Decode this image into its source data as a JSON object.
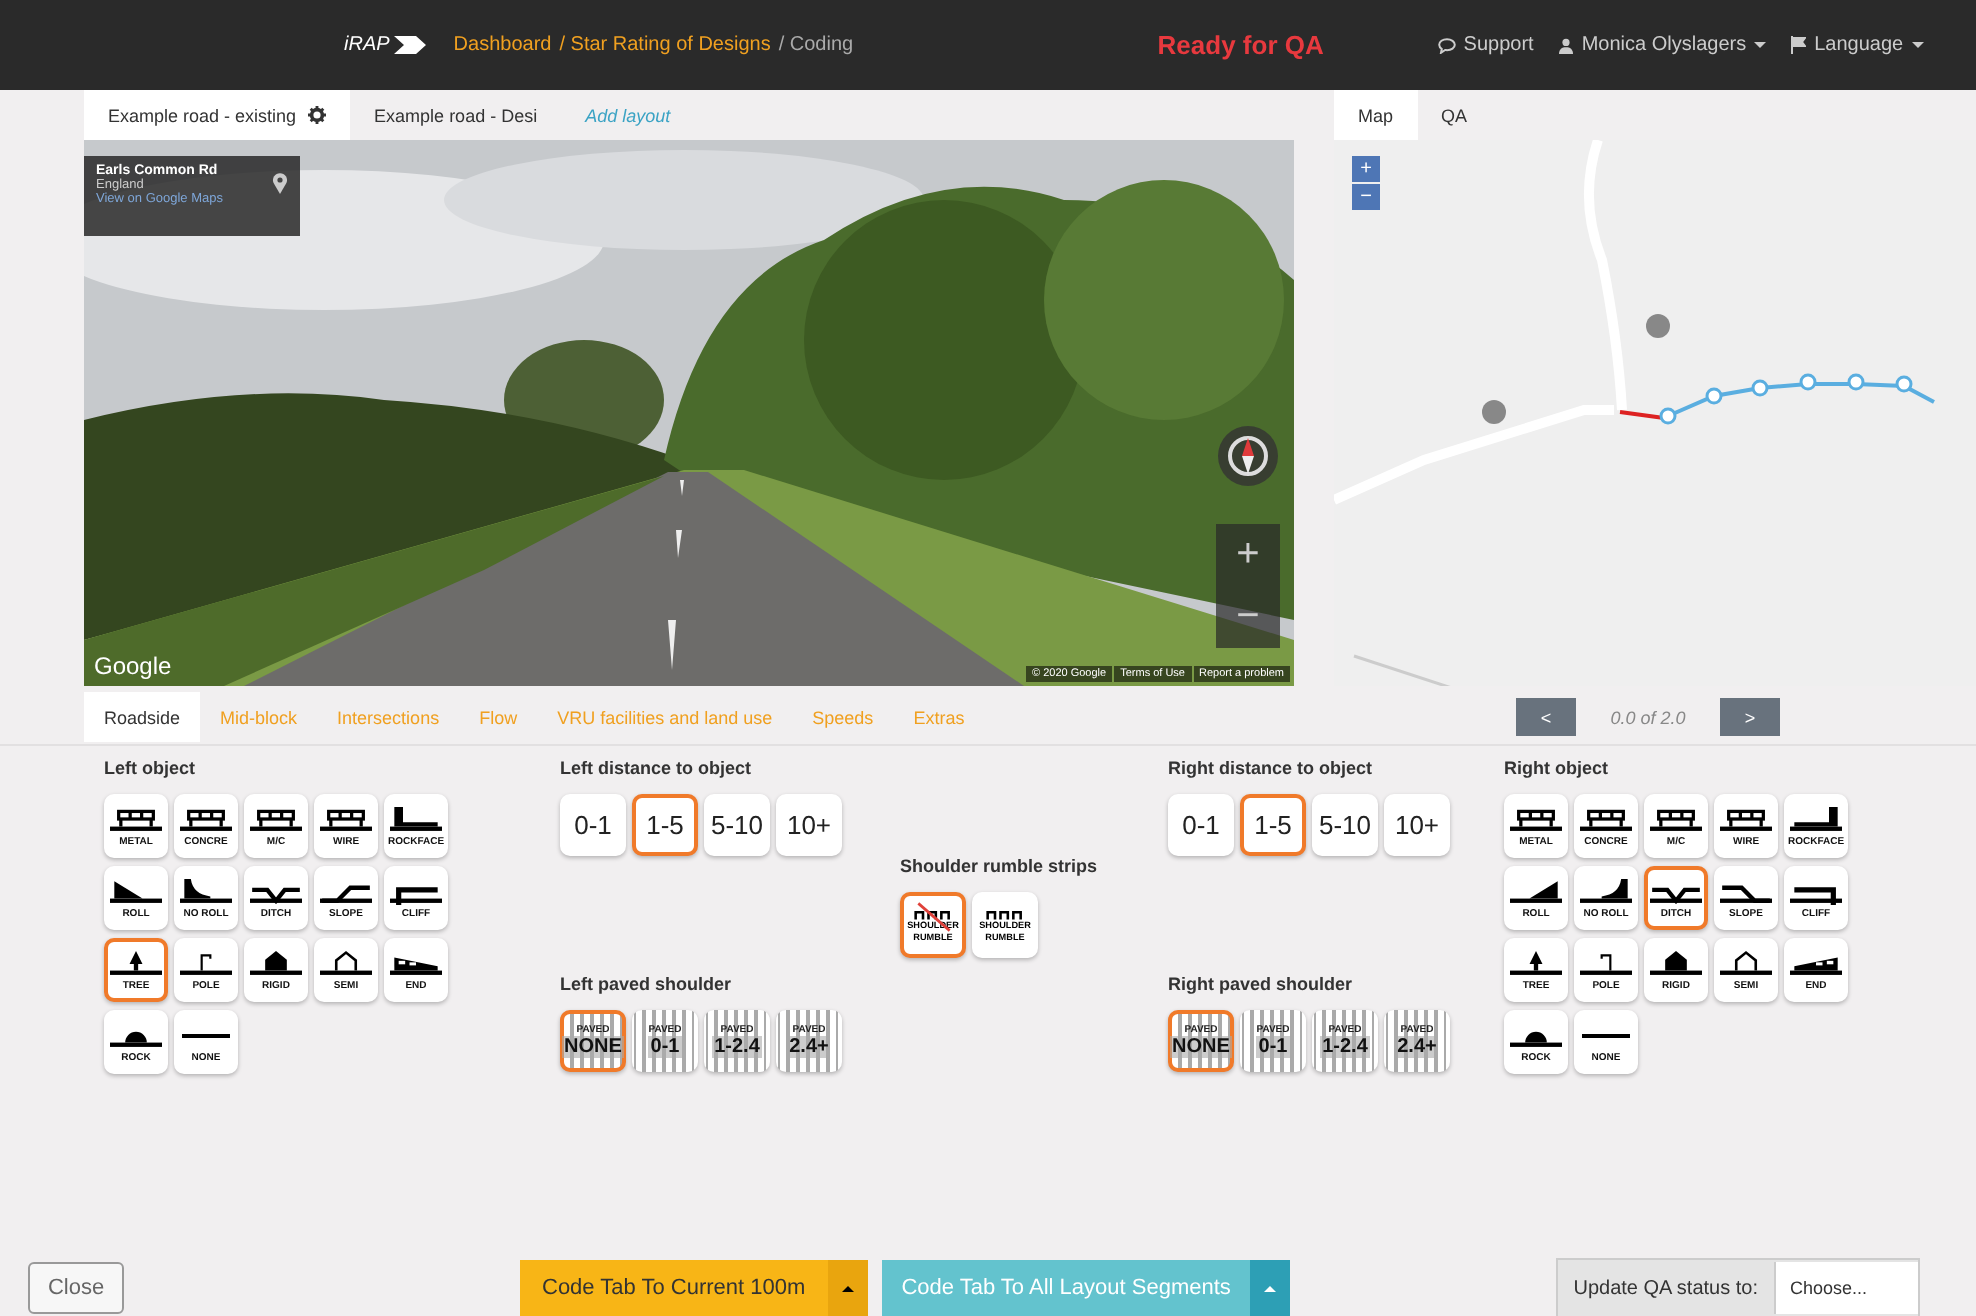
{
  "header": {
    "logo": "iRAP",
    "breadcrumb": [
      {
        "label": "Dashboard",
        "kind": "link"
      },
      {
        "label": "/ Star Rating of Designs",
        "kind": "link"
      },
      {
        "label": "/ Coding",
        "kind": "current"
      }
    ],
    "status": "Ready for QA",
    "menu": [
      {
        "label": "Support",
        "dropdown": false
      },
      {
        "label": "Monica Olyslagers",
        "dropdown": true
      },
      {
        "label": "Language",
        "dropdown": true
      }
    ]
  },
  "layout_tabs": [
    {
      "label": "Example road - existing",
      "kind": "layout",
      "selected": true,
      "settings": true
    },
    {
      "label": "Example road - Desi",
      "kind": "layout",
      "selected": false,
      "settings": false
    },
    {
      "label": "Add layout",
      "kind": "add",
      "selected": false,
      "settings": false
    }
  ],
  "street_view": {
    "place": {
      "title": "Earls Common Rd",
      "subtitle": "England",
      "link": "View on Google Maps"
    },
    "logo": "Google",
    "footer": [
      "© 2020 Google",
      "Terms of Use",
      "Report a problem"
    ],
    "zoom": [
      "+",
      "−"
    ]
  },
  "map_panel": {
    "tabs": [
      {
        "label": "Map",
        "selected": true
      },
      {
        "label": "QA",
        "selected": false
      }
    ],
    "zoom": [
      "+",
      "−"
    ]
  },
  "category_tabs": [
    {
      "label": "Roadside",
      "selected": true
    },
    {
      "label": "Mid-block",
      "selected": false
    },
    {
      "label": "Intersections",
      "selected": false
    },
    {
      "label": "Flow",
      "selected": false
    },
    {
      "label": "VRU facilities and land use",
      "selected": false
    },
    {
      "label": "Speeds",
      "selected": false
    },
    {
      "label": "Extras",
      "selected": false
    }
  ],
  "pager": {
    "prev": "<",
    "reading": "0.0 of 2.0",
    "next": ">"
  },
  "left_object": {
    "title": "Left object",
    "mirrored": false,
    "options": [
      {
        "label": "METAL",
        "kind": "barrier",
        "selected": false
      },
      {
        "label": "CONCRE",
        "kind": "barrier",
        "selected": false
      },
      {
        "label": "M/C",
        "kind": "barrier",
        "selected": false
      },
      {
        "label": "WIRE",
        "kind": "barrier",
        "selected": false
      },
      {
        "label": "ROCKFACE",
        "kind": "rockface",
        "selected": false
      },
      {
        "label": "ROLL",
        "kind": "roll",
        "selected": false
      },
      {
        "label": "NO ROLL",
        "kind": "noroll",
        "selected": false
      },
      {
        "label": "DITCH",
        "kind": "ditch",
        "selected": false
      },
      {
        "label": "SLOPE",
        "kind": "slope",
        "selected": false
      },
      {
        "label": "CLIFF",
        "kind": "cliff",
        "selected": false
      },
      {
        "label": "TREE",
        "kind": "tree",
        "selected": true
      },
      {
        "label": "POLE",
        "kind": "pole",
        "selected": false
      },
      {
        "label": "RIGID",
        "kind": "rigid",
        "selected": false
      },
      {
        "label": "SEMI",
        "kind": "semi",
        "selected": false
      },
      {
        "label": "END",
        "kind": "end",
        "selected": false
      },
      {
        "label": "ROCK",
        "kind": "rock",
        "selected": false
      },
      {
        "label": "NONE",
        "kind": "none",
        "selected": false
      }
    ]
  },
  "left_distance": {
    "title": "Left distance to object",
    "options": [
      {
        "label": "0-1",
        "selected": false
      },
      {
        "label": "1-5",
        "selected": true
      },
      {
        "label": "5-10",
        "selected": false
      },
      {
        "label": "10+",
        "selected": false
      }
    ]
  },
  "left_shoulder": {
    "title": "Left paved shoulder",
    "options": [
      {
        "top": "PAVED",
        "label": "NONE",
        "selected": true
      },
      {
        "top": "PAVED",
        "label": "0-1",
        "selected": false
      },
      {
        "top": "PAVED",
        "label": "1-2.4",
        "selected": false
      },
      {
        "top": "PAVED",
        "label": "2.4+",
        "selected": false
      }
    ]
  },
  "rumble_strips": {
    "title": "Shoulder rumble strips",
    "options": [
      {
        "label": "SHOULDER RUMBLE",
        "kind": "absent",
        "selected": true
      },
      {
        "label": "SHOULDER RUMBLE",
        "kind": "present",
        "selected": false
      }
    ]
  },
  "right_distance": {
    "title": "Right distance to object",
    "options": [
      {
        "label": "0-1",
        "selected": false
      },
      {
        "label": "1-5",
        "selected": true
      },
      {
        "label": "5-10",
        "selected": false
      },
      {
        "label": "10+",
        "selected": false
      }
    ]
  },
  "right_shoulder": {
    "title": "Right paved shoulder",
    "options": [
      {
        "top": "PAVED",
        "label": "NONE",
        "selected": true
      },
      {
        "top": "PAVED",
        "label": "0-1",
        "selected": false
      },
      {
        "top": "PAVED",
        "label": "1-2.4",
        "selected": false
      },
      {
        "top": "PAVED",
        "label": "2.4+",
        "selected": false
      }
    ]
  },
  "right_object": {
    "title": "Right object",
    "mirrored": true,
    "options": [
      {
        "label": "METAL",
        "kind": "barrier",
        "selected": false
      },
      {
        "label": "CONCRE",
        "kind": "barrier",
        "selected": false
      },
      {
        "label": "M/C",
        "kind": "barrier",
        "selected": false
      },
      {
        "label": "WIRE",
        "kind": "barrier",
        "selected": false
      },
      {
        "label": "ROCKFACE",
        "kind": "rockface",
        "selected": false
      },
      {
        "label": "ROLL",
        "kind": "roll",
        "selected": false
      },
      {
        "label": "NO ROLL",
        "kind": "noroll",
        "selected": false
      },
      {
        "label": "DITCH",
        "kind": "ditch",
        "selected": true
      },
      {
        "label": "SLOPE",
        "kind": "slope",
        "selected": false
      },
      {
        "label": "CLIFF",
        "kind": "cliff",
        "selected": false
      },
      {
        "label": "TREE",
        "kind": "tree",
        "selected": false
      },
      {
        "label": "POLE",
        "kind": "pole",
        "selected": false
      },
      {
        "label": "RIGID",
        "kind": "rigid",
        "selected": false
      },
      {
        "label": "SEMI",
        "kind": "semi",
        "selected": false
      },
      {
        "label": "END",
        "kind": "end",
        "selected": false
      },
      {
        "label": "ROCK",
        "kind": "rock",
        "selected": false
      },
      {
        "label": "NONE",
        "kind": "none",
        "selected": false
      }
    ]
  },
  "footer": {
    "close": "Close",
    "primary": {
      "label": "Code Tab To Current 100m"
    },
    "secondary": {
      "label": "Code Tab To All Layout Segments"
    },
    "qa_label": "Update QA status to:",
    "qa_select": {
      "value": "Choose..."
    }
  }
}
